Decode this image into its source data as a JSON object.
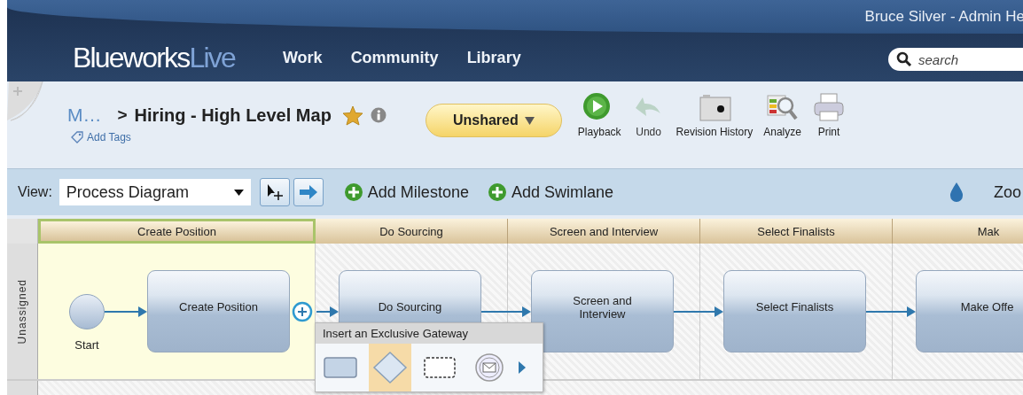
{
  "header": {
    "user": "Bruce Silver - Admin He",
    "logo": {
      "part_1": "Blueworks",
      "part_2": "Live"
    },
    "nav": [
      "Work",
      "Community",
      "Library"
    ],
    "search": {
      "placeholder": "search"
    }
  },
  "document": {
    "breadcrumb": "M…",
    "separator": ">",
    "title": "Hiring - High Level Map",
    "favorite": true,
    "add_tags": "Add Tags",
    "share_button": "Unshared"
  },
  "toolbar": [
    {
      "kind": "playback",
      "label": "Playback",
      "disabled": false
    },
    {
      "kind": "undo",
      "label": "Undo",
      "disabled": true
    },
    {
      "kind": "revision",
      "label": "Revision History",
      "disabled": false
    },
    {
      "kind": "analyze",
      "label": "Analyze",
      "disabled": false
    },
    {
      "kind": "print",
      "label": "Print",
      "disabled": false
    }
  ],
  "view_bar": {
    "label": "View:",
    "view": "Process Diagram",
    "actions": [
      "Add Milestone",
      "Add Swimlane"
    ],
    "zoom_label": "Zoo"
  },
  "diagram": {
    "milestones": [
      {
        "label": "Create Position",
        "selected": true
      },
      {
        "label": "Do Sourcing",
        "selected": false
      },
      {
        "label": "Screen and Interview",
        "selected": false
      },
      {
        "label": "Select Finalists",
        "selected": false
      },
      {
        "label": "Mak",
        "selected": false
      }
    ],
    "lanes": [
      {
        "label": "Unassigned",
        "cells": [
          [
            {
              "kind": "start",
              "label": "Start"
            },
            {
              "kind": "task",
              "label": "Create Position"
            }
          ],
          [
            {
              "kind": "task",
              "label": "Do Sourcing"
            }
          ],
          [
            {
              "kind": "task",
              "label": "Screen and Interview"
            }
          ],
          [
            {
              "kind": "task",
              "label": "Select Finalists"
            }
          ],
          [
            {
              "kind": "task",
              "label": "Make Offe"
            }
          ]
        ]
      }
    ],
    "popup": {
      "title": "Insert an Exclusive Gateway",
      "options": [
        {
          "kind": "task",
          "selected": false
        },
        {
          "kind": "gateway",
          "selected": true
        },
        {
          "kind": "subprocess",
          "selected": false
        },
        {
          "kind": "event",
          "selected": false
        }
      ]
    }
  }
}
